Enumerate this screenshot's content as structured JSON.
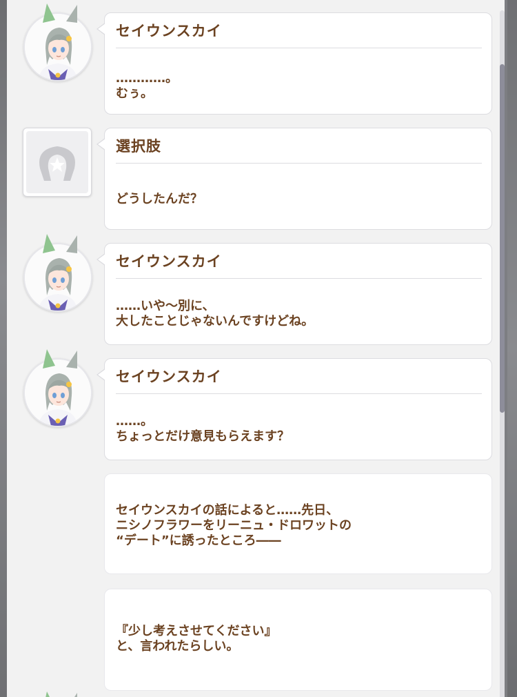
{
  "log": [
    {
      "type": "character",
      "speaker": "セイウンスカイ",
      "lines": [
        "…………。",
        "むぅ。"
      ]
    },
    {
      "type": "choice",
      "speaker": "選択肢",
      "lines": [
        "どうしたんだ？"
      ]
    },
    {
      "type": "character",
      "speaker": "セイウンスカイ",
      "lines": [
        "……いや～別に、",
        "大したことじゃないんですけどね。"
      ]
    },
    {
      "type": "character",
      "speaker": "セイウンスカイ",
      "lines": [
        "……。",
        "ちょっとだけ意見もらえます？"
      ]
    },
    {
      "type": "narration",
      "lines": [
        "セイウンスカイの話によると……先日、",
        "ニシノフラワーをリーニュ・ドロワットの",
        "“デート”に誘ったところ――"
      ]
    },
    {
      "type": "narration",
      "lines": [
        "『少し考えさせてください』",
        "と、言われたらしい。"
      ]
    }
  ],
  "colors": {
    "text": "#6b4221",
    "panel": "#f2f2f2",
    "bubble": "#ffffff",
    "hair": "#a9b2ad",
    "ear": "#8fc48f",
    "eyes": "#6f9fd6",
    "uniform_collar": "#6a5fb3",
    "scrollbar": "#8d8d9a"
  },
  "icons": {
    "character_avatar": "seiun-sky-avatar-icon",
    "choice_avatar": "horseshoe-star-icon"
  }
}
